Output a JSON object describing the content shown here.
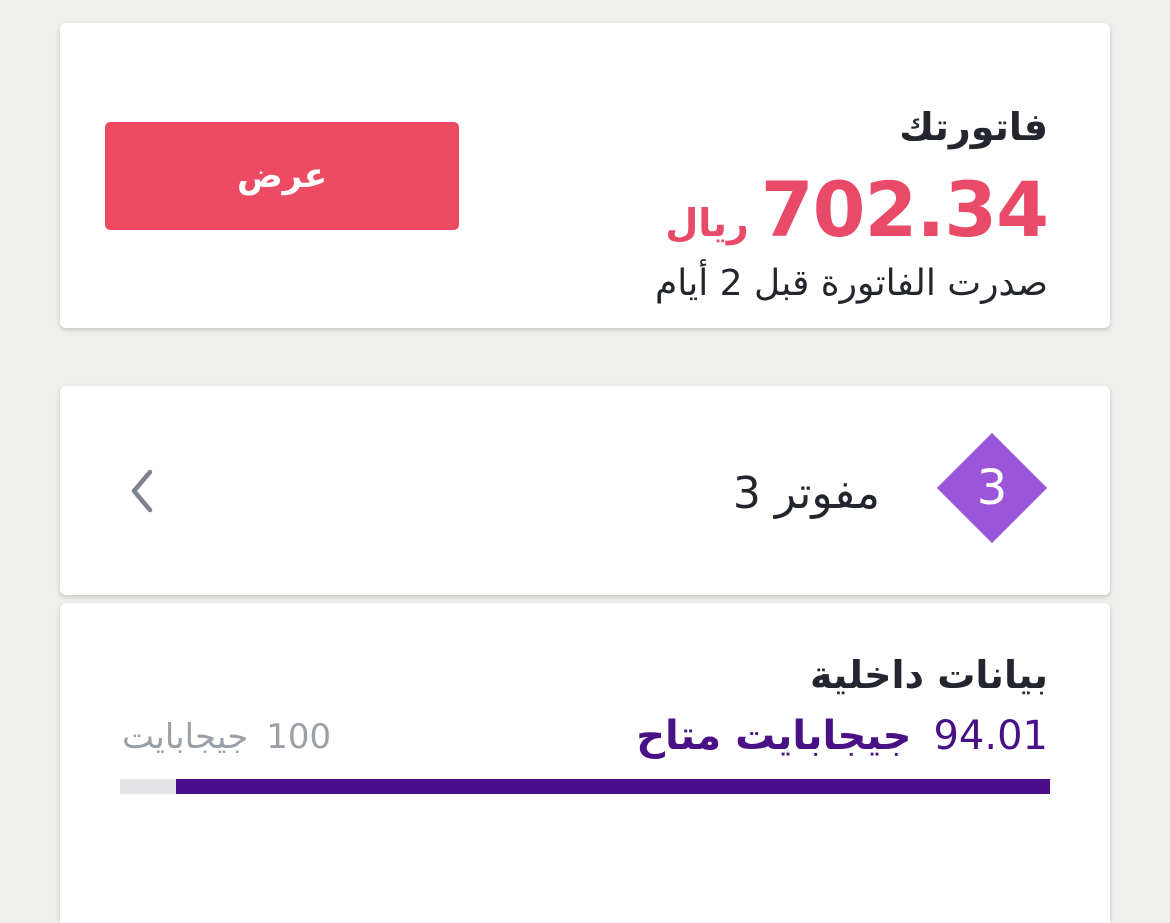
{
  "bill": {
    "title": "فاتورتك",
    "amount": "702.34",
    "currency": "ريال",
    "issued_text": "صدرت الفاتورة قبل 2 أيام",
    "view_button_label": "عرض",
    "accent_color": "#e84a67"
  },
  "lines": {
    "badge_number": "3",
    "label": "مفوتر 3",
    "icons": {
      "badge": "diamond-badge-icon",
      "chevron": "chevron-left-icon"
    }
  },
  "data_usage": {
    "title": "بيانات داخلية",
    "available_value": "94.01",
    "available_unit": "جيجابايت متاح",
    "total_value": "100",
    "total_unit": "جيجابايت",
    "progress_fraction": 0.9401,
    "accent_color": "#4a0e8a"
  }
}
